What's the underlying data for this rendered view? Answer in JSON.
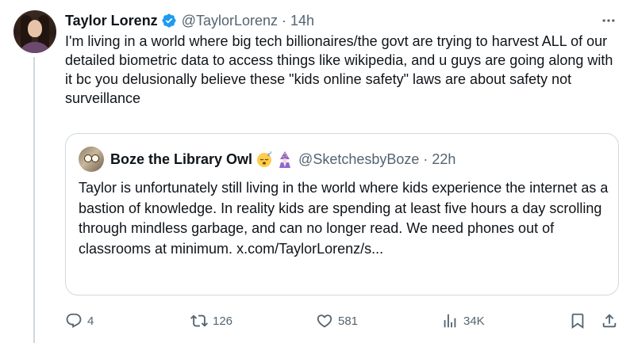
{
  "tweet": {
    "author_name": "Taylor Lorenz",
    "author_handle": "@TaylorLorenz",
    "separator": "·",
    "time": "14h",
    "text": "I'm living in a world where big tech billionaires/the govt are trying to harvest ALL of our detailed biometric data to access things like wikipedia, and u guys are going along with it bc you delusionally believe these \"kids online safety\" laws are about safety not surveillance"
  },
  "quote": {
    "author_name": "Boze the Library Owl",
    "emojis": [
      "sleeping-face",
      "mage"
    ],
    "author_handle": "@SketchesbyBoze",
    "separator": "·",
    "time": "22h",
    "text": "Taylor is unfortunately still living in the world where kids experience the internet as a bastion of knowledge. In reality kids are spending at least five hours a day scrolling through mindless garbage, and can no longer read. We need phones out of classrooms at minimum.",
    "link": "x.com/TaylorLorenz/s..."
  },
  "actions": {
    "replies": "4",
    "reposts": "126",
    "likes": "581",
    "views": "34K"
  },
  "colors": {
    "text_primary": "#0f1419",
    "text_secondary": "#536471",
    "verified_blue": "#1d9bf0",
    "border": "#cfd9de"
  }
}
